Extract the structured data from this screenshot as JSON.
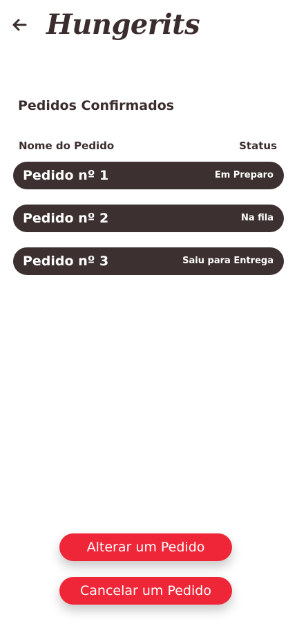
{
  "header": {
    "back_icon": "arrow-left-icon",
    "logo": "Hungerits"
  },
  "section": {
    "title": "Pedidos Confirmados",
    "col_name": "Nome do Pedido",
    "col_status": "Status"
  },
  "orders": [
    {
      "name": "Pedido nº 1",
      "status": "Em Preparo"
    },
    {
      "name": "Pedido nº 2",
      "status": "Na fila"
    },
    {
      "name": "Pedido nº 3",
      "status": "Saiu para Entrega"
    }
  ],
  "actions": {
    "alter_label": "Alterar um Pedido",
    "cancel_label": "Cancelar um Pedido"
  },
  "colors": {
    "primary_dark": "#3d3030",
    "accent_red": "#ee2638",
    "background": "#ffffff"
  }
}
